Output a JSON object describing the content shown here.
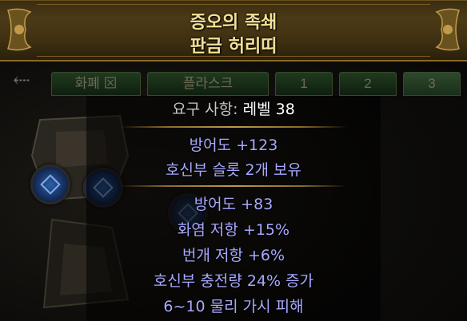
{
  "background": {
    "tabs": [
      {
        "label": "화폐"
      },
      {
        "label": "플라스크"
      },
      {
        "label": "1"
      },
      {
        "label": "2"
      },
      {
        "label": "3"
      }
    ]
  },
  "item": {
    "name": "증오의 족쇄",
    "base_type": "판금 허리띠",
    "requirement_label": "요구 사항:",
    "requirement_value": "레벨 38",
    "implicit_mods": [
      "방어도 +123",
      "호신부 슬롯 2개 보유"
    ],
    "explicit_mods": [
      "방어도 +83",
      "화염 저항 +15%",
      "번개 저항 +6%",
      "호신부 충전량 24% 증가",
      "6~10 물리 가시 피해"
    ]
  },
  "colors": {
    "title": "#f4e096",
    "magic_mod": "#a8a8ff",
    "header_bg": "#3a2d12",
    "border": "#8a6a2a"
  }
}
